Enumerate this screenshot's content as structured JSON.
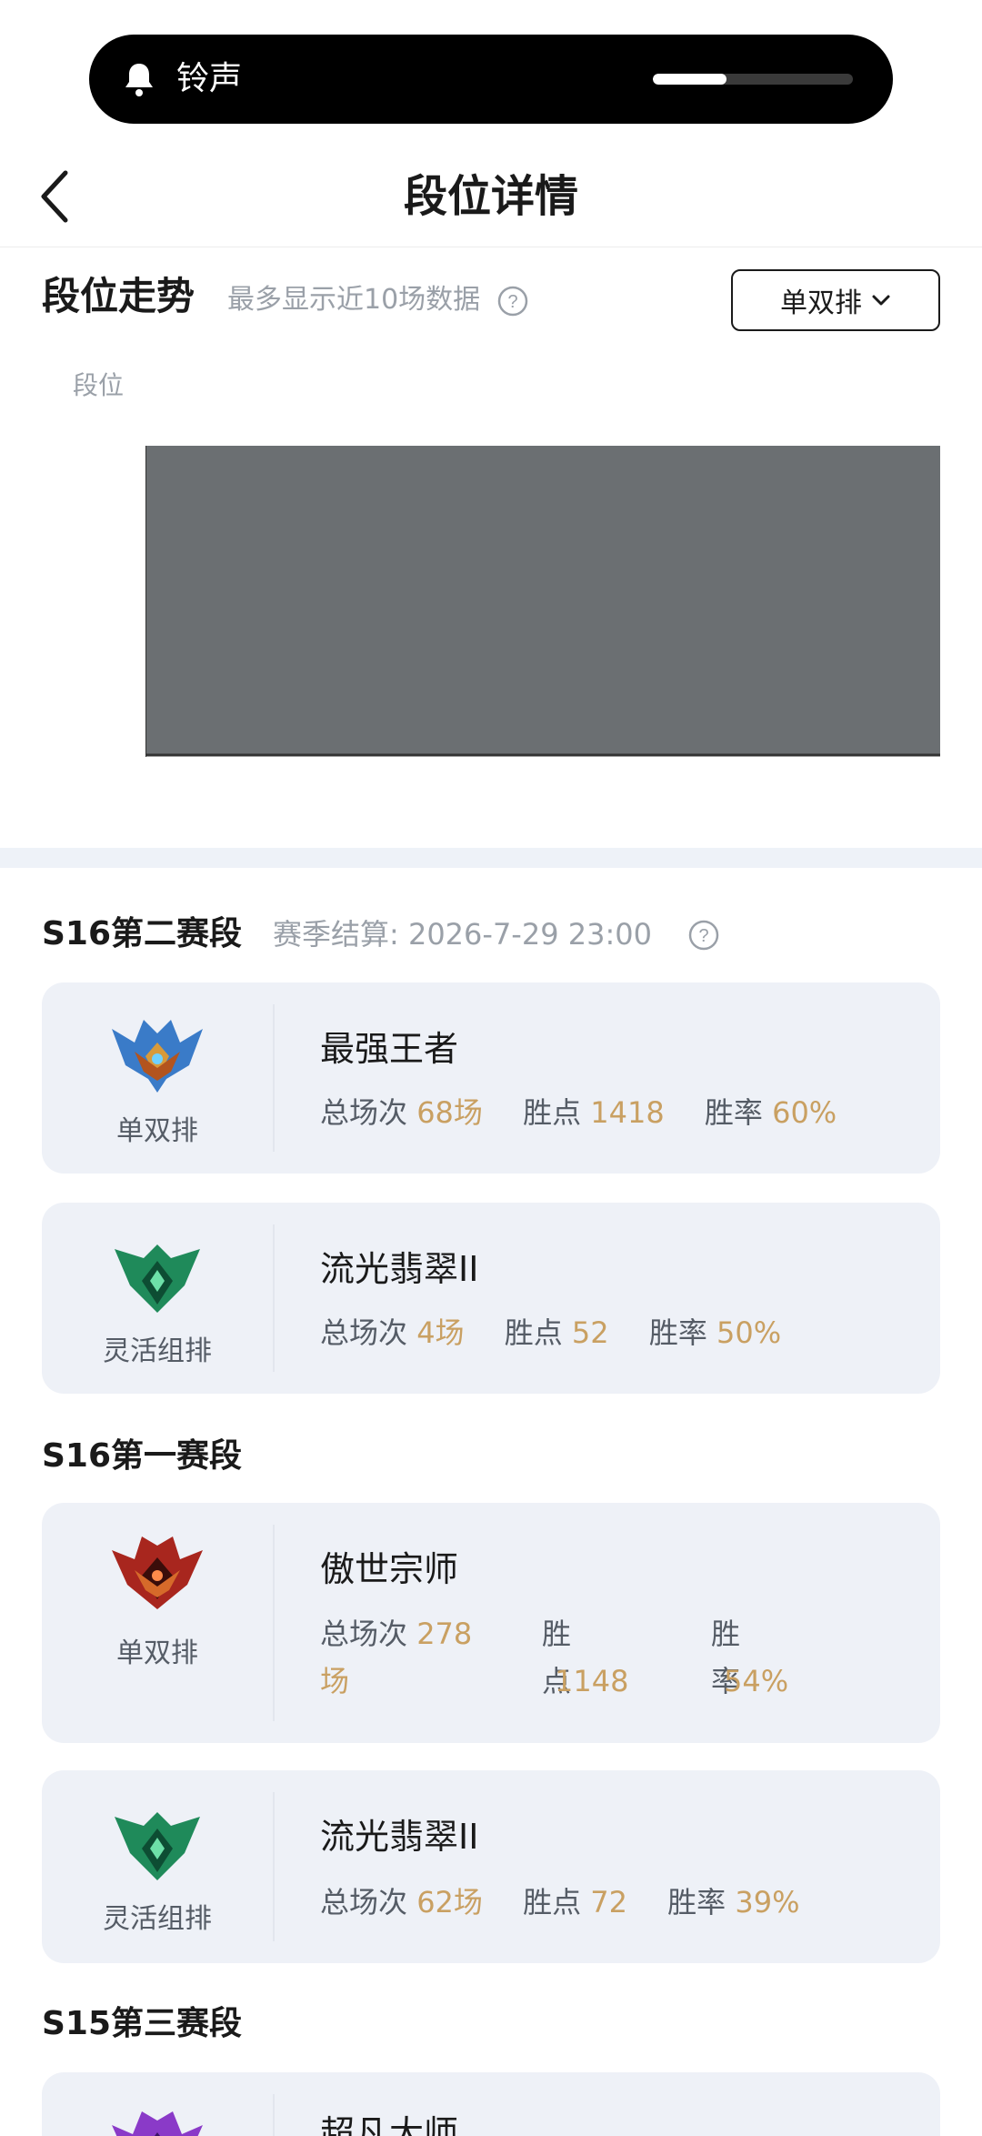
{
  "status": {
    "ringer_label": "铃声",
    "volume_level": 0.37
  },
  "header": {
    "title": "段位详情"
  },
  "trend": {
    "title": "段位走势",
    "subtitle": "最多显示近10场数据",
    "queue_select": "单双排",
    "axis_label": "段位"
  },
  "colors": {
    "accent": "#c9a062",
    "card_bg": "#eef1f7",
    "chart_fill": "#6b6f72"
  },
  "seasons": [
    {
      "title": "S16第二赛段",
      "meta": "赛季结算: 2026-7-29 23:00",
      "cards": [
        {
          "queue": "单双排",
          "emblem": "challenger-emblem-icon",
          "rank": "最强王者",
          "games_label": "总场次",
          "games": "68场",
          "lp_label": "胜点",
          "lp": "1418",
          "wr_label": "胜率",
          "wr": "60%"
        },
        {
          "queue": "灵活组排",
          "emblem": "emerald-emblem-icon",
          "rank": "流光翡翠II",
          "games_label": "总场次",
          "games": "4场",
          "lp_label": "胜点",
          "lp": "52",
          "wr_label": "胜率",
          "wr": "50%"
        }
      ]
    },
    {
      "title": "S16第一赛段",
      "cards": [
        {
          "queue": "单双排",
          "emblem": "grandmaster-emblem-icon",
          "rank": "傲世宗师",
          "games_label": "总场次",
          "games_a": "278",
          "games_b": "场",
          "lp_label": "胜点",
          "lp": "1148",
          "wr_label": "胜率",
          "wr": "54%"
        },
        {
          "queue": "灵活组排",
          "emblem": "emerald-emblem-icon",
          "rank": "流光翡翠II",
          "games_label": "总场次",
          "games": "62场",
          "lp_label": "胜点",
          "lp": "72",
          "wr_label": "胜率",
          "wr": "39%"
        }
      ]
    },
    {
      "title": "S15第三赛段",
      "cards": [
        {
          "queue": "",
          "emblem": "master-emblem-icon",
          "rank": "超凡大师"
        }
      ]
    }
  ]
}
